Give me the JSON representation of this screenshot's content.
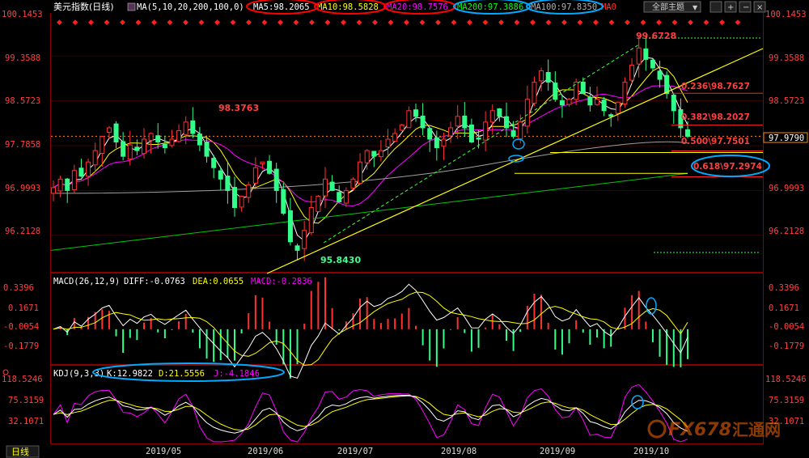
{
  "header": {
    "title": "美元指数(日线)",
    "ma_label": "MA(5,10,20,200,100,0)",
    "ma_items": [
      {
        "text": "MA5:98.2065",
        "color": "#ffffff"
      },
      {
        "text": "MA10:98.5828",
        "color": "#ffff00"
      },
      {
        "text": "MA20:98.7576",
        "color": "#ff00ff"
      },
      {
        "text": "MA200:97.3886",
        "color": "#00ff00"
      },
      {
        "text": "MA100:97.8350",
        "color": "#a0a0a0"
      },
      {
        "text": "MA0",
        "color": "#ff3030"
      }
    ],
    "topic_button": "全部主题"
  },
  "price_axis": {
    "left": [
      "100.1453",
      "99.3588",
      "98.5723",
      "97.7858",
      "96.9993",
      "96.2128"
    ],
    "right": [
      "100.1453",
      "99.3588",
      "98.5723",
      "97.9790",
      "96.9993",
      "96.2128"
    ]
  },
  "annotations": {
    "high_left": "98.3763",
    "high_peak": "99.6728",
    "low": "95.8430",
    "last_price": "97.9790",
    "fib": [
      {
        "text": "0.236\\98.7627",
        "value": 98.7627
      },
      {
        "text": "0.382\\98.2027",
        "value": 98.2027
      },
      {
        "text": "0.500\\97.7501",
        "value": 97.7501
      },
      {
        "text": "0.618\\97.2974",
        "value": 97.2974
      }
    ]
  },
  "macd": {
    "label": "MACD(26,12,9)",
    "diff": "DIFF:-0.0763",
    "dea": "DEA:0.0655",
    "macd": "MACD:-0.2836",
    "axis": [
      "0.3396",
      "0.1671",
      "-0.0054",
      "-0.1779"
    ]
  },
  "kdj": {
    "label": "KDJ(9,3,3)",
    "k": "K:12.9822",
    "d": "D:21.5556",
    "j": "J:-4.1846",
    "axis": [
      "118.5246",
      "75.3159",
      "32.1071"
    ]
  },
  "x_axis": {
    "timeframe_button": "日线",
    "months": [
      "2019/05",
      "2019/06",
      "2019/07",
      "2019/08",
      "2019/09",
      "2019/10"
    ]
  },
  "watermark": {
    "text": "FX678",
    "cn": "汇通网"
  },
  "colors": {
    "up": "#ff3232",
    "down": "#32ff8a",
    "ma5": "#ffffff",
    "ma10": "#ffff00",
    "ma20": "#ff00ff",
    "ma200": "#00c800",
    "ma100": "#a0a0a0",
    "trendline": "#ffff00",
    "grid": "#8b0000"
  },
  "chart_data": {
    "type": "candlestick",
    "title": "美元指数(日线)",
    "price_range": [
      95.6,
      100.2
    ],
    "key_levels": {
      "high": 99.6728,
      "low": 95.843,
      "last": 97.979,
      "left_high": 98.3763
    },
    "moving_averages": {
      "MA5": 98.2065,
      "MA10": 98.5828,
      "MA20": 98.7576,
      "MA200": 97.3886,
      "MA100": 97.835
    },
    "close_path": [
      97.05,
      97.2,
      97.0,
      97.35,
      97.25,
      97.5,
      97.7,
      97.95,
      98.1,
      97.85,
      97.6,
      97.8,
      97.7,
      97.9,
      98.0,
      97.85,
      97.75,
      97.9,
      98.05,
      98.2,
      98.0,
      97.8,
      97.6,
      97.4,
      97.2,
      97.0,
      96.7,
      96.9,
      97.1,
      97.4,
      97.5,
      97.3,
      97.0,
      96.6,
      96.1,
      95.95,
      96.3,
      96.7,
      96.9,
      97.2,
      97.0,
      96.8,
      97.0,
      97.2,
      97.5,
      97.7,
      97.6,
      97.7,
      97.9,
      98.0,
      98.15,
      98.4,
      98.3,
      98.1,
      97.9,
      97.75,
      97.9,
      98.1,
      98.3,
      98.1,
      97.85,
      97.9,
      98.2,
      98.4,
      98.3,
      98.1,
      97.95,
      98.2,
      98.6,
      98.9,
      99.1,
      98.9,
      98.6,
      98.5,
      98.6,
      98.9,
      98.7,
      98.5,
      98.6,
      98.4,
      98.3,
      98.55,
      98.9,
      99.2,
      99.5,
      99.3,
      99.15,
      98.95,
      98.7,
      98.4,
      98.1,
      97.95
    ],
    "macd": {
      "diff": -0.0763,
      "dea": 0.0655,
      "macd": -0.2836,
      "range": [
        -0.3,
        0.42
      ]
    },
    "kdj": {
      "k": 12.9822,
      "d": 21.5556,
      "j": -4.1846,
      "range": [
        -10,
        125
      ]
    },
    "x_ticks": [
      "2019/05",
      "2019/06",
      "2019/07",
      "2019/08",
      "2019/09",
      "2019/10"
    ]
  }
}
